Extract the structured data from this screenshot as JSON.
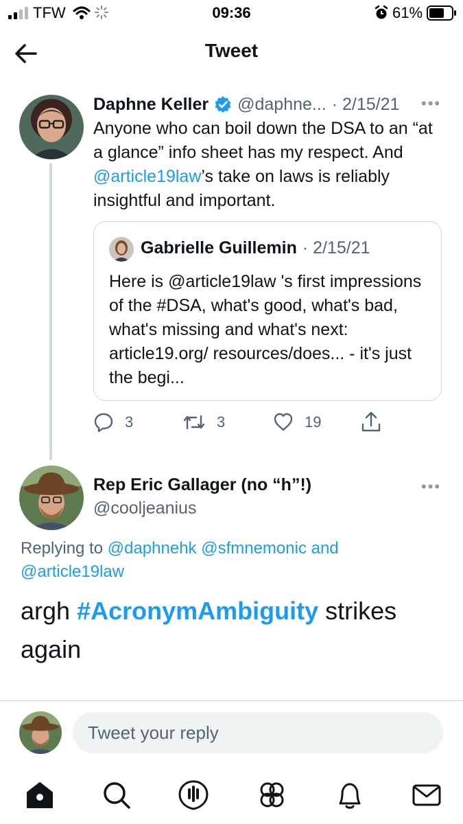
{
  "status_bar": {
    "carrier": "TFW",
    "time": "09:36",
    "battery": "61%"
  },
  "header": {
    "title": "Tweet",
    "back_icon": "arrow-left-icon"
  },
  "main_tweet": {
    "author_name": "Daphne Keller",
    "verified": true,
    "handle": "@daphne...",
    "date": "· 2/15/21",
    "text_before": "Anyone who can boil down the DSA to an “at a glance” info sheet has my respect. And ",
    "mention": "@article19law",
    "text_after": "’s take on laws is reliably insightful and important.",
    "quote": {
      "author_name": "Gabrielle Guillemin",
      "date": "· 2/15/21",
      "text": "Here is @article19law 's first impressions of the #DSA, what's good, what's bad, what's missing and what's next: article19.org/ resources/does... - it's just the begi..."
    },
    "actions": {
      "replies": "3",
      "retweets": "3",
      "likes": "19"
    }
  },
  "reply_tweet": {
    "author_name": "Rep Eric Gallager (no “h”!)",
    "handle": "@cooljeanius",
    "replying_label": "Replying to ",
    "replying_to": "@daphnehk @sfmnemonic",
    "replying_and": " and",
    "replying_to_2": "@article19law",
    "text_before": "argh ",
    "hashtag": "#AcronymAmbiguity",
    "text_after": " strikes again"
  },
  "composer": {
    "placeholder": "Tweet your reply"
  },
  "tab_bar": [
    "home-icon",
    "search-icon",
    "spaces-icon",
    "communities-icon",
    "notifications-icon",
    "messages-icon"
  ],
  "colors": {
    "accent": "#1d9bf0",
    "text": "#0f1419",
    "muted": "#536471",
    "verified": "#1d9bf0"
  }
}
